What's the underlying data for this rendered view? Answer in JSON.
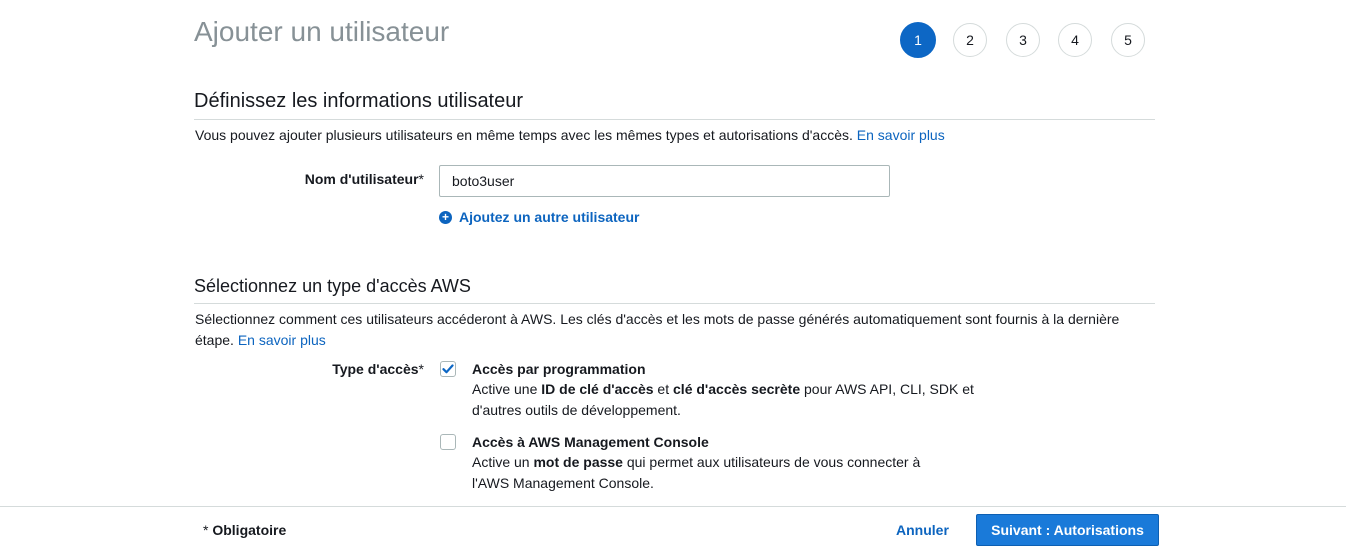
{
  "page": {
    "title": "Ajouter un utilisateur"
  },
  "steps": [
    {
      "label": "1",
      "active": true
    },
    {
      "label": "2",
      "active": false
    },
    {
      "label": "3",
      "active": false
    },
    {
      "label": "4",
      "active": false
    },
    {
      "label": "5",
      "active": false
    }
  ],
  "user_details": {
    "heading": "Définissez les informations utilisateur",
    "description": "Vous pouvez ajouter plusieurs utilisateurs en même temps avec les mêmes types et autorisations d'accès.",
    "learn_more": "En savoir plus",
    "username_label": "Nom d'utilisateur",
    "required_mark": "*",
    "username_value": "boto3user",
    "add_user_label": "Ajoutez un autre utilisateur"
  },
  "access_type": {
    "heading": "Sélectionnez un type d'accès AWS",
    "description": "Sélectionnez comment ces utilisateurs accéderont à AWS. Les clés d'accès et les mots de passe générés automatiquement sont fournis à la dernière étape.",
    "learn_more": "En savoir plus",
    "label": "Type d'accès",
    "required_mark": "*",
    "options": [
      {
        "title": "Accès par programmation",
        "checked": true,
        "desc_part1": "Active une ",
        "desc_bold1": "ID de clé d'accès",
        "desc_part2": " et ",
        "desc_bold2": "clé d'accès secrète",
        "desc_part3": " pour AWS API, CLI, SDK et",
        "desc_line2": "d'autres outils de développement."
      },
      {
        "title": "Accès à AWS Management Console",
        "checked": false,
        "desc_part1": "Active un ",
        "desc_bold1": "mot de passe",
        "desc_part2": " qui permet aux utilisateurs de vous connecter à",
        "desc_line2": "l'AWS Management Console."
      }
    ]
  },
  "footer": {
    "required_star": "*",
    "required_note": "Obligatoire",
    "cancel_label": "Annuler",
    "next_label": "Suivant : Autorisations"
  },
  "colors": {
    "accent": "#0d67c5",
    "link": "#0c64bf",
    "primary_button": "#1a7ad9",
    "title_gray": "#879196"
  }
}
